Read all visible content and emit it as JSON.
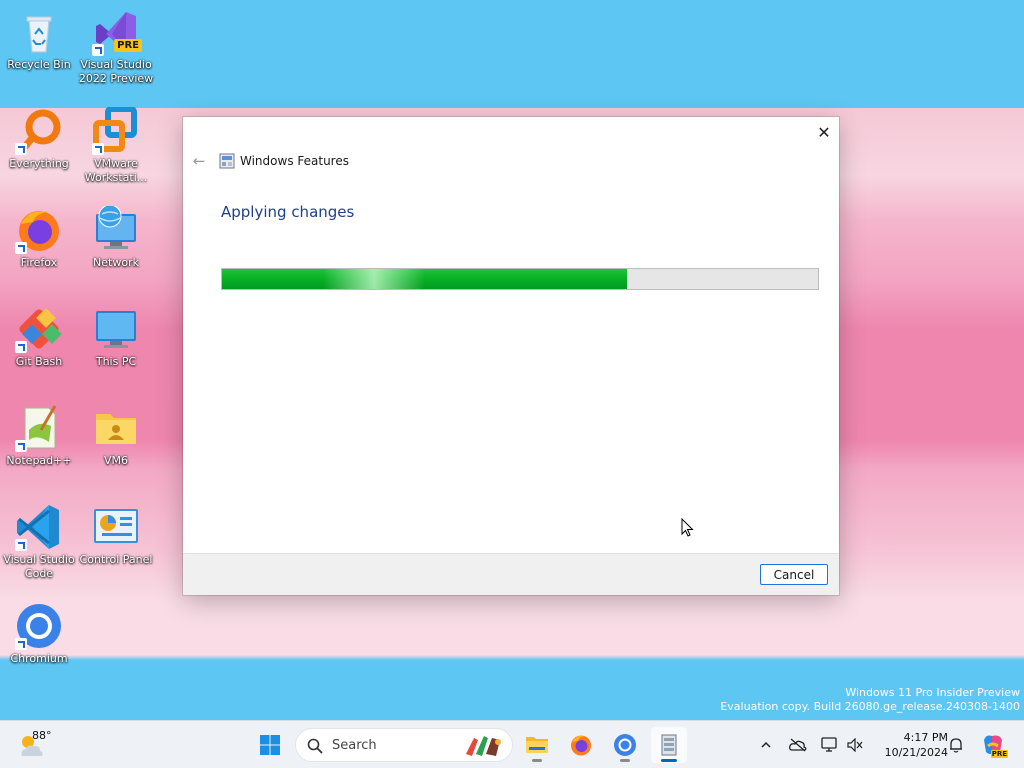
{
  "desktop": {
    "icons": [
      {
        "label": "Recycle Bin",
        "icon": "recycle-bin-icon"
      },
      {
        "label": "Visual Studio 2022 Preview",
        "icon": "visual-studio-icon",
        "badge": "PRE"
      },
      {
        "label": "Everything",
        "icon": "everything-search-icon"
      },
      {
        "label": "VMware Workstati...",
        "icon": "vmware-icon"
      },
      {
        "label": "Firefox",
        "icon": "firefox-icon"
      },
      {
        "label": "Network",
        "icon": "network-icon"
      },
      {
        "label": "Git Bash",
        "icon": "git-bash-icon"
      },
      {
        "label": "This PC",
        "icon": "this-pc-icon"
      },
      {
        "label": "Notepad++",
        "icon": "notepad-plus-plus-icon"
      },
      {
        "label": "VM6",
        "icon": "folder-icon"
      },
      {
        "label": "Visual Studio Code",
        "icon": "vscode-icon"
      },
      {
        "label": "Control Panel",
        "icon": "control-panel-icon"
      },
      {
        "label": "Chromium",
        "icon": "chromium-icon"
      }
    ],
    "watermark": {
      "line1": "Windows 11 Pro Insider Preview",
      "line2": "Evaluation copy. Build 26080.ge_release.240308-1400"
    }
  },
  "window": {
    "title": "Windows Features",
    "heading": "Applying changes",
    "progress_percent": 68,
    "cancel_label": "Cancel",
    "close_glyph": "✕",
    "back_glyph": "←"
  },
  "taskbar": {
    "weather": {
      "temp": "88°"
    },
    "search": {
      "placeholder": "Search"
    },
    "apps": [
      {
        "name": "start-button",
        "icon": "windows-start-icon"
      },
      {
        "name": "file-explorer-button",
        "icon": "folder-icon"
      },
      {
        "name": "firefox-button",
        "icon": "firefox-icon"
      },
      {
        "name": "chromium-button",
        "icon": "chromium-icon"
      },
      {
        "name": "windows-features-button",
        "icon": "windows-features-icon"
      }
    ],
    "clock": {
      "time": "4:17 PM",
      "date": "10/21/2024"
    },
    "copilot_badge": "PRE"
  },
  "colors": {
    "accent": "#0067c0",
    "progress_green": "#06b025",
    "heading_blue": "#1e3f8a"
  }
}
